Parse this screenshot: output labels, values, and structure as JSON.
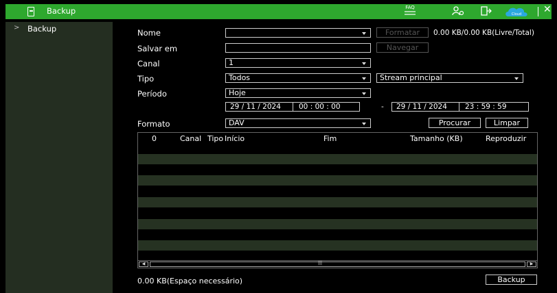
{
  "titlebar": {
    "title": "Backup",
    "faq_label": "FAQ",
    "cloud_label": "Cloud"
  },
  "sidebar": {
    "items": [
      {
        "label": "Backup"
      }
    ]
  },
  "form": {
    "nome_label": "Nome",
    "nome_value": "",
    "formatar_label": "Formatar",
    "capacity": "0.00 KB/0.00 KB(Livre/Total)",
    "salvar_label": "Salvar em",
    "salvar_value": "",
    "navegar_label": "Navegar",
    "canal_label": "Canal",
    "canal_value": "1",
    "tipo_label": "Tipo",
    "tipo_value": "Todos",
    "stream_value": "Stream principal",
    "periodo_label": "Período",
    "periodo_value": "Hoje",
    "start_date": "29 / 11 / 2024",
    "start_time": "00 : 00 : 00",
    "range_sep": "-",
    "end_date": "29 / 11 / 2024",
    "end_time": "23 : 59 : 59",
    "formato_label": "Formato",
    "formato_value": "DAV",
    "procurar_label": "Procurar",
    "limpar_label": "Limpar"
  },
  "table": {
    "columns": [
      "0",
      "Canal",
      "Tipo",
      "Início",
      "Fim",
      "Tamanho (KB)",
      "Reproduzir"
    ],
    "rows": []
  },
  "footer": {
    "space_needed": "0.00 KB(Espaço necessário)",
    "backup_label": "Backup"
  },
  "colors": {
    "titlebar": "#2ea82e",
    "sidebar": "#242e21",
    "row_alt": "#263222",
    "cloud": "#2aa8e0"
  }
}
